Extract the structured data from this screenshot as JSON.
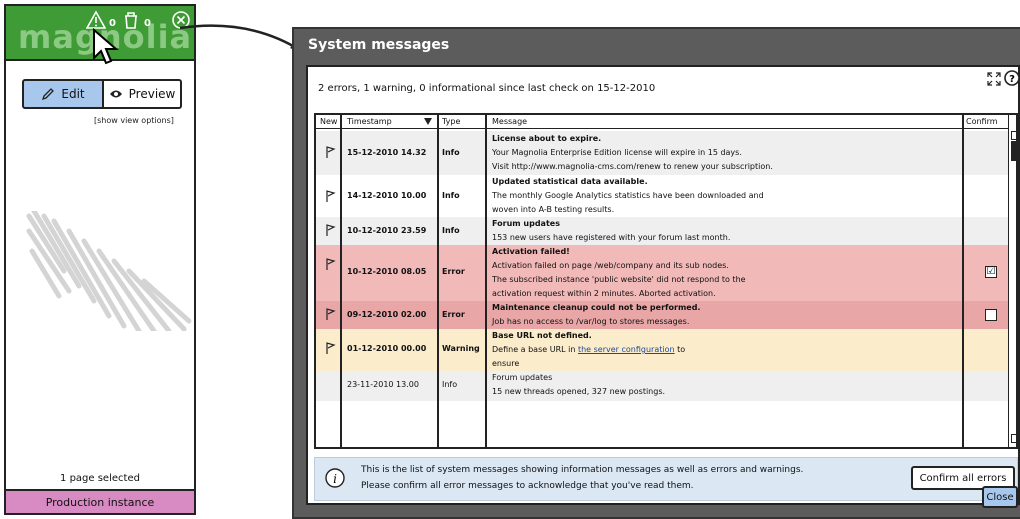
{
  "left": {
    "logo": "magnolia",
    "warn_count": "0",
    "bin_count": "0",
    "edit_label": "Edit",
    "preview_label": "Preview",
    "view_options": "[show view options]",
    "page_selected": "1 page selected",
    "production": "Production instance"
  },
  "dialog": {
    "title": "System messages",
    "summary": "2 errors, 1 warning, 0 informational since last check on 15-12-2010",
    "headers": {
      "new": "New",
      "timestamp": "Timestamp",
      "type": "Type",
      "message": "Message",
      "confirm": "Confirm"
    },
    "rows": [
      {
        "timestamp": "15-12-2010 14.32",
        "type": "Info",
        "title": "License about to expire.",
        "lines": [
          "Your Magnolia Enterprise Edition license will expire in 15 days.",
          "Visit http://www.magnolia-cms.com/renew to renew your subscription."
        ]
      },
      {
        "timestamp": "14-12-2010 10.00",
        "type": "Info",
        "title": "Updated statistical data available.",
        "lines": [
          "The monthly Google Analytics statistics have been downloaded and",
          "woven into A-B testing results."
        ]
      },
      {
        "timestamp": "10-12-2010 23.59",
        "type": "Info",
        "title": "Forum updates",
        "lines": [
          "153 new users have registered with your forum last month."
        ]
      },
      {
        "timestamp": "10-12-2010 08.05",
        "type": "Error",
        "title": "Activation failed!",
        "lines": [
          "Activation failed on page /web/company and its sub nodes.",
          "The subscribed instance 'public website' did not respond to the",
          "activation request within 2 minutes. Aborted activation."
        ],
        "confirm": "☑"
      },
      {
        "timestamp": "09-12-2010 02.00",
        "type": "Error",
        "title": "Maintenance cleanup could not be performed.",
        "lines": [
          "Job has no access to /var/log to stores messages."
        ],
        "confirm": ""
      },
      {
        "timestamp": "01-12-2010 00.00",
        "type": "Warning",
        "title": "Base URL not defined.",
        "line_pre": "Define a base URL in ",
        "line_link": "the server configuration",
        "line_post": " to",
        "lines": [
          "ensure"
        ]
      },
      {
        "timestamp": "23-11-2010 13.00",
        "type": "Info",
        "title": "Forum updates",
        "lines": [
          "15 new threads opened, 327 new postings."
        ]
      }
    ],
    "info_line1": "This is the list of system messages showing information messages as well as errors and warnings.",
    "info_line2": "Please confirm all error messages to acknowledge that you've read them.",
    "confirm_all": "Confirm all errors",
    "close": "Close"
  },
  "colors": {
    "brand_green": "#3e9b35",
    "error_row": "#f2b9b9",
    "warning_row": "#fbeccb",
    "info_row": "#efefef",
    "edit_blue": "#a7c8ec",
    "production_pink": "#d88bc2"
  }
}
